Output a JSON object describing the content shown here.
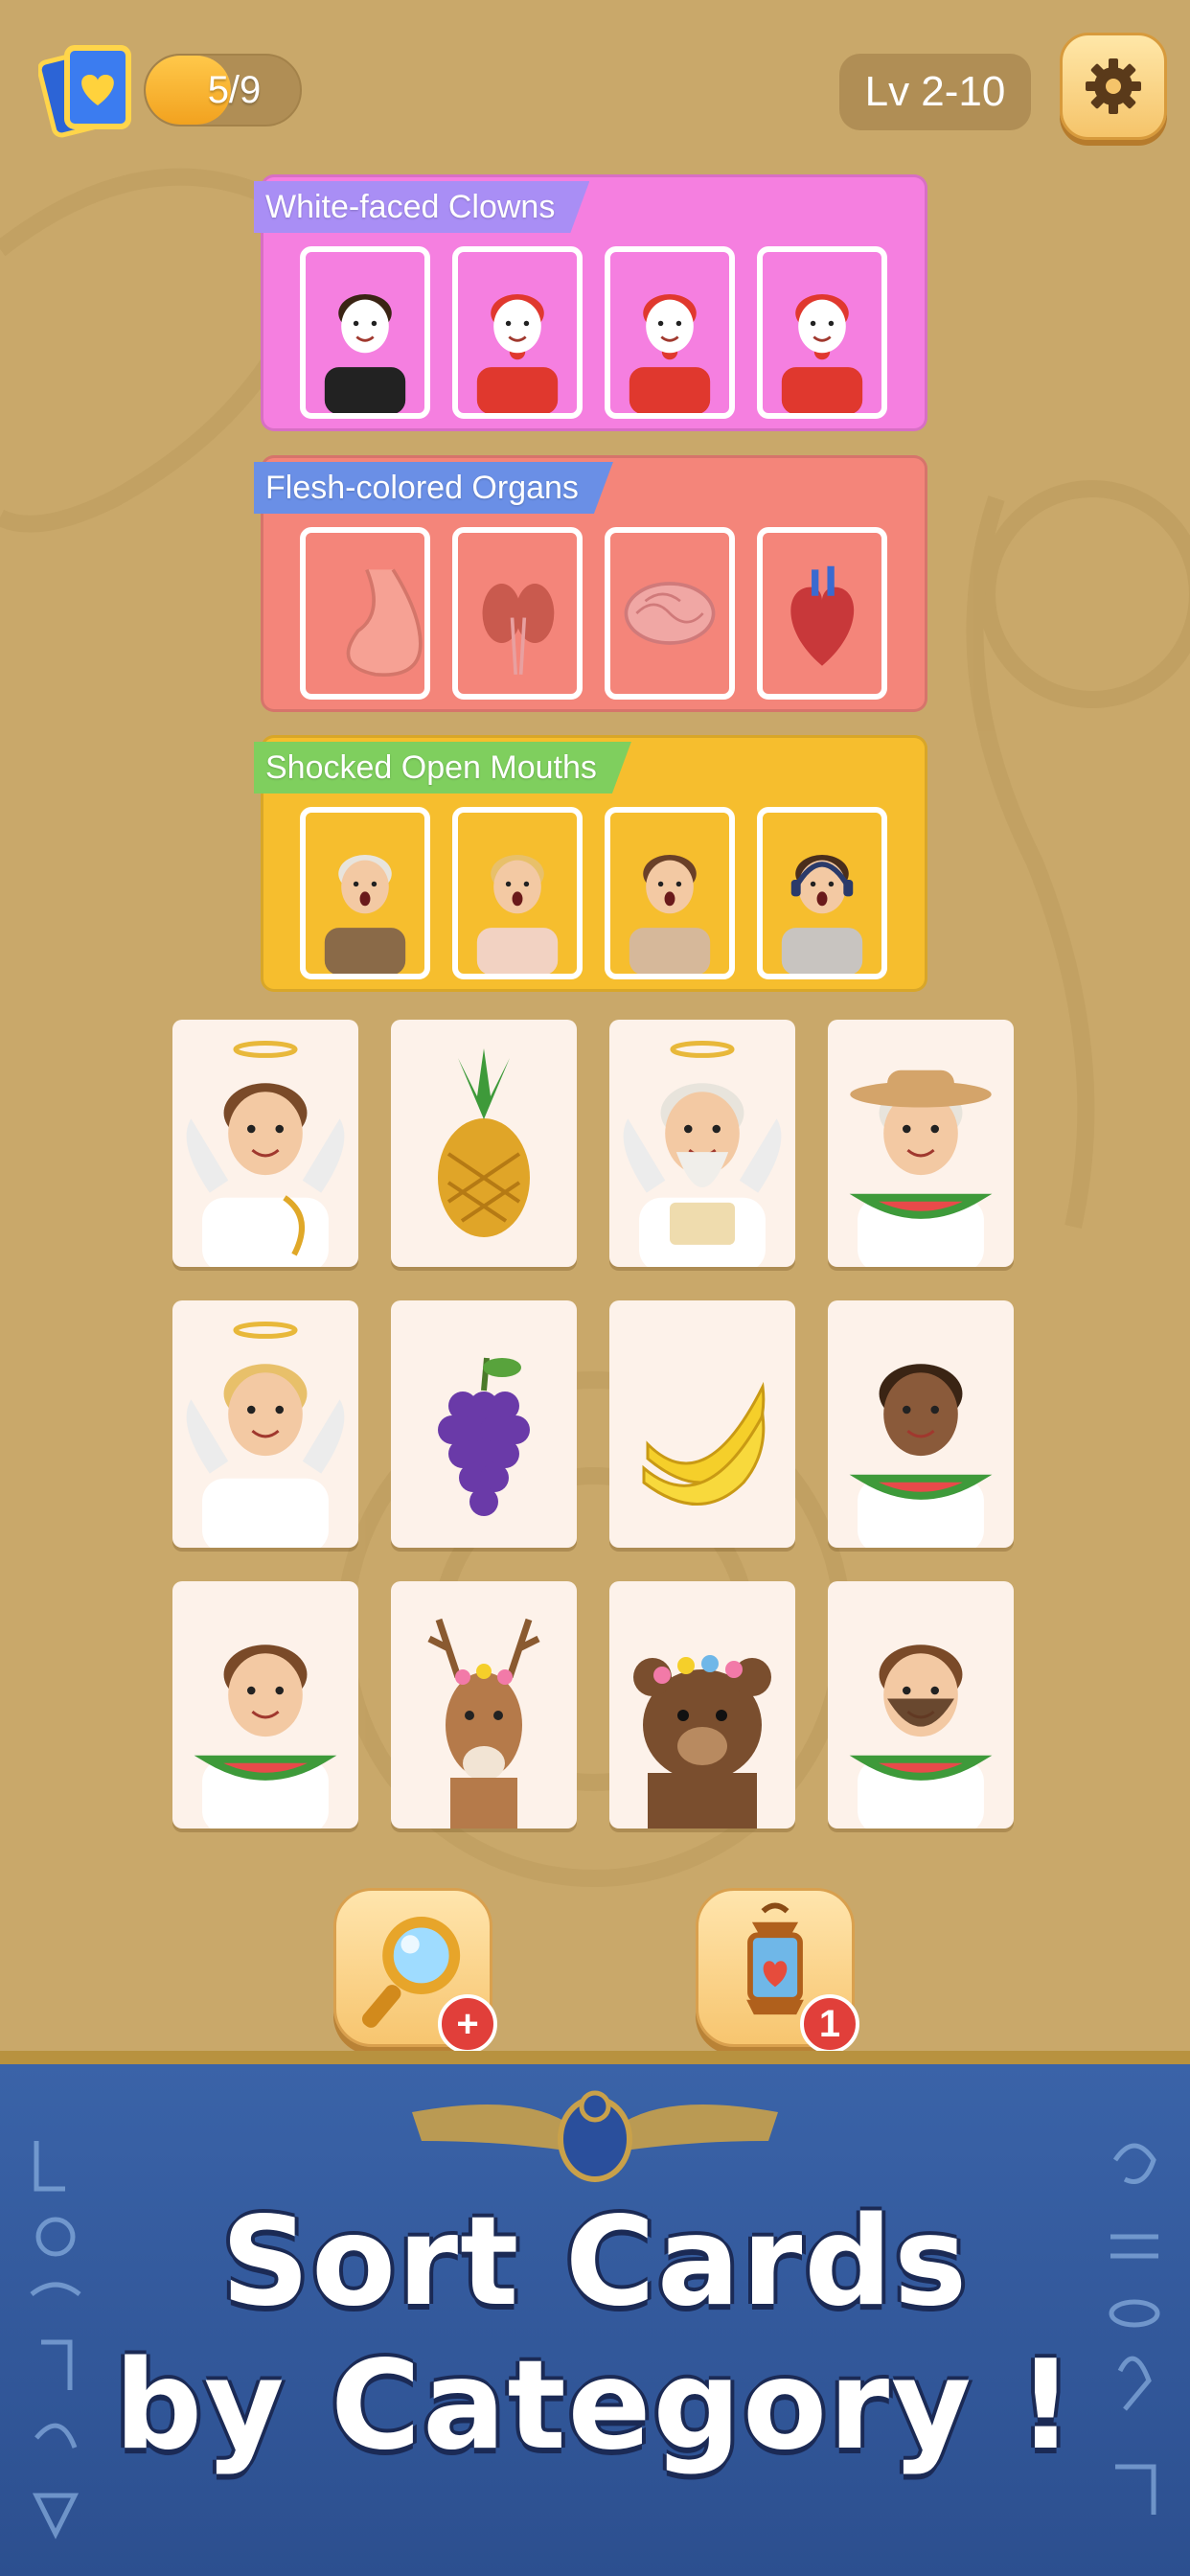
{
  "hud": {
    "progress_text": "5/9",
    "progress_fraction": 0.5556,
    "level_text": "Lv 2-10",
    "deck_icon": "card-deck-heart-icon",
    "settings_icon": "gear-icon"
  },
  "categories": [
    {
      "label": "White-faced Clowns",
      "panel_color": "#f57fe0",
      "label_color": "#a98ef5",
      "cards": [
        "mime",
        "harlequin-jester",
        "polka-dot-clown",
        "jester-clown"
      ]
    },
    {
      "label": "Flesh-colored Organs",
      "panel_color": "#f4857a",
      "label_color": "#6a8fe6",
      "cards": [
        "stomach",
        "kidneys",
        "brain",
        "heart"
      ]
    },
    {
      "label": "Shocked Open Mouths",
      "panel_color": "#f6be2e",
      "label_color": "#7fcf5e",
      "cards": [
        "shocked-old-man",
        "shocked-blonde-woman",
        "shocked-man",
        "shocked-teen-headphones"
      ]
    }
  ],
  "grid_cards": [
    "cherub-with-lyre",
    "pineapple",
    "old-sage-with-scroll",
    "grandma-eating-watermelon",
    "angel-woman",
    "grapes",
    "bananas",
    "woman-eating-watermelon",
    "boy-eating-watermelon",
    "deer-with-flower-crown",
    "bear-with-flower-crown",
    "bearded-man-eating-watermelon"
  ],
  "boosters": [
    {
      "icon": "magnifier-icon",
      "badge": "+"
    },
    {
      "icon": "lantern-icon",
      "badge": "1"
    }
  ],
  "banner": {
    "line1": "Sort Cards",
    "line2": "by Category !"
  },
  "colors": {
    "background": "#c9a86a",
    "banner": "#3a63a8",
    "card_face": "#fdf2ea"
  }
}
